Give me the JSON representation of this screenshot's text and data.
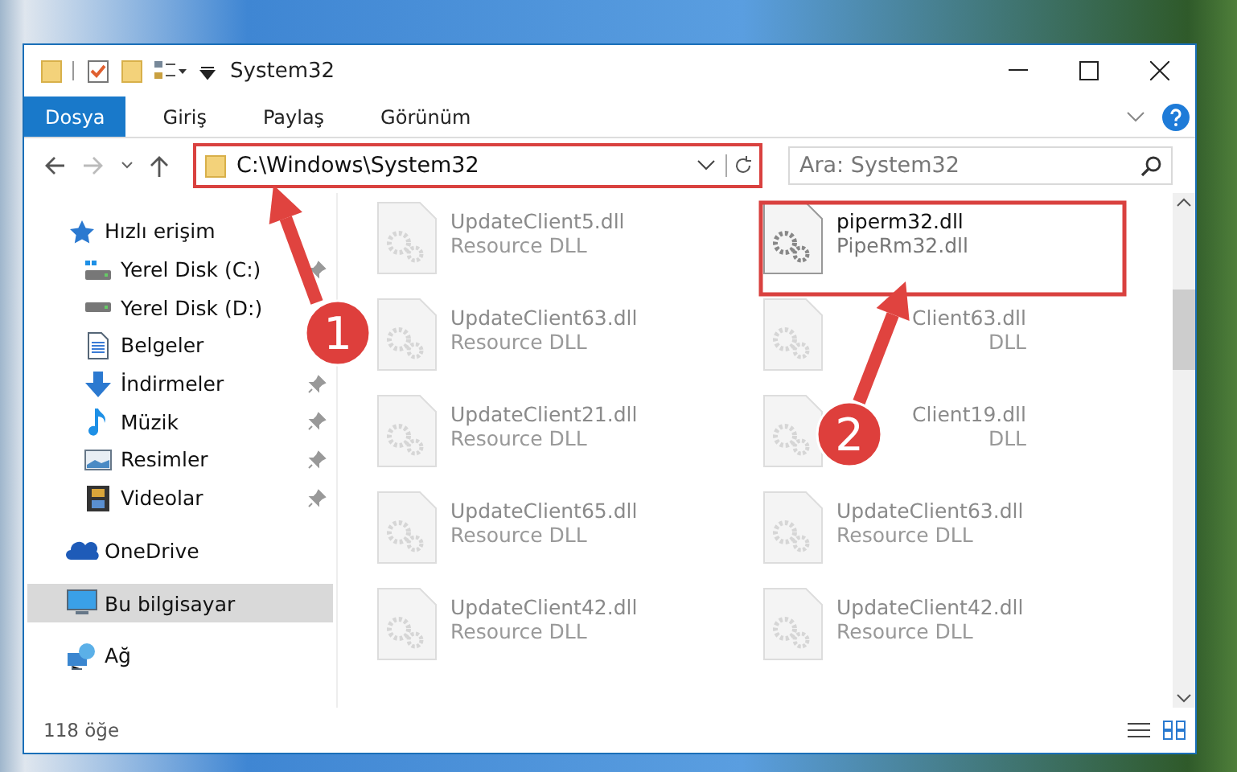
{
  "window": {
    "title": "System32"
  },
  "ribbon": {
    "tabs": [
      {
        "label": "Dosya",
        "selected": true
      },
      {
        "label": "Giriş",
        "selected": false
      },
      {
        "label": "Paylaş",
        "selected": false
      },
      {
        "label": "Görünüm",
        "selected": false
      }
    ]
  },
  "address_bar": {
    "path": "C:\\Windows\\System32"
  },
  "search": {
    "placeholder": "Ara: System32"
  },
  "sidebar": {
    "items": [
      {
        "label": "Hızlı erişim",
        "selected": false,
        "children": [
          {
            "label": "Yerel Disk (C:)",
            "pinned": true,
            "selected": false
          },
          {
            "label": "Yerel Disk (D:)",
            "pinned": false,
            "selected": false
          },
          {
            "label": "Belgeler",
            "pinned": false,
            "selected": false
          },
          {
            "label": "İndirmeler",
            "pinned": true,
            "selected": false
          },
          {
            "label": "Müzik",
            "pinned": true,
            "selected": false
          },
          {
            "label": "Resimler",
            "pinned": true,
            "selected": false
          },
          {
            "label": "Videolar",
            "pinned": true,
            "selected": false
          }
        ]
      },
      {
        "label": "OneDrive",
        "selected": false
      },
      {
        "label": "Bu bilgisayar",
        "selected": true
      },
      {
        "label": "Ağ",
        "selected": false
      }
    ]
  },
  "files": [
    {
      "name": "UpdateClient5.dll",
      "type": "Resource DLL",
      "blurred": true
    },
    {
      "name": "piperm32.dll",
      "type": "PipeRm32.dll",
      "blurred": false
    },
    {
      "name": "UpdateClient63.dll",
      "type": "Resource DLL",
      "blurred": true
    },
    {
      "name": "Client63.dll",
      "type": "DLL",
      "blurred": true,
      "cut": true
    },
    {
      "name": "UpdateClient21.dll",
      "type": "Resource DLL",
      "blurred": true
    },
    {
      "name": "Client19.dll",
      "type": "DLL",
      "blurred": true,
      "cut": true
    },
    {
      "name": "UpdateClient65.dll",
      "type": "Resource DLL",
      "blurred": true
    },
    {
      "name": "UpdateClient63.dll",
      "type": "Resource DLL",
      "blurred": true
    },
    {
      "name": "UpdateClient42.dll",
      "type": "Resource DLL",
      "blurred": true
    },
    {
      "name": "UpdateClient42.dll",
      "type": "Resource DLL",
      "blurred": true
    }
  ],
  "status_bar": {
    "count": "118 öğe"
  },
  "annotations": [
    {
      "kind": "box"
    },
    {
      "kind": "box"
    },
    {
      "kind": "arrow",
      "label": "1"
    },
    {
      "kind": "arrow",
      "label": "2"
    }
  ]
}
